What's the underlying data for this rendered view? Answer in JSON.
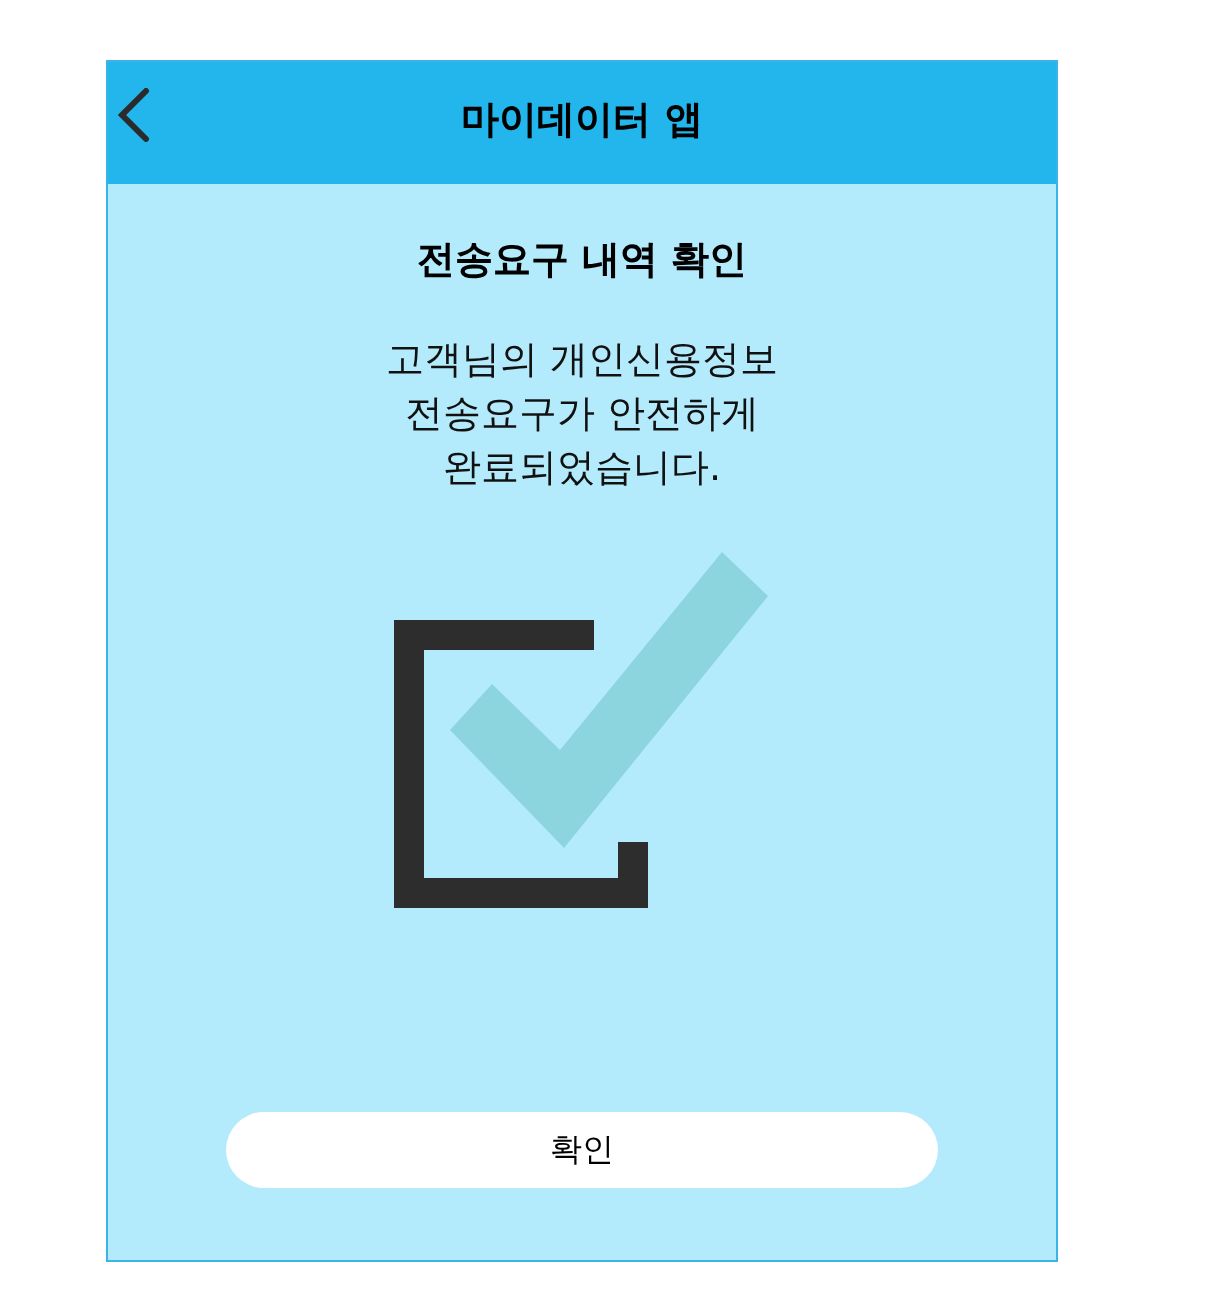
{
  "header": {
    "title": "마이데이터 앱"
  },
  "heading": "전송요구 내역 확인",
  "message": "고객님의 개인신용정보\n전송요구가 안전하게\n완료되었습니다.",
  "confirm_button": {
    "label": "확인"
  }
}
